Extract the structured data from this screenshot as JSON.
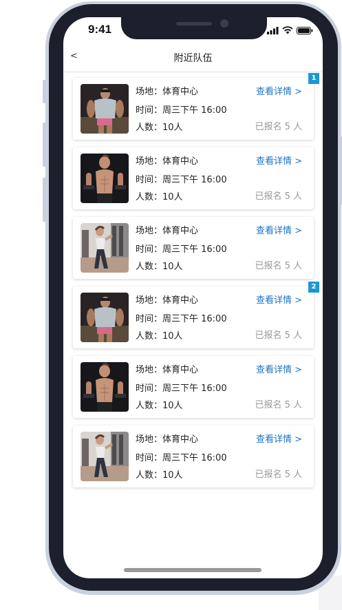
{
  "status_bar": {
    "time": "9:41"
  },
  "nav": {
    "back": "<",
    "title": "附近队伍"
  },
  "cards": [
    {
      "venue": "场地：体育中心",
      "time": "时间：周三下午 16:00",
      "people": "人数：10人",
      "link": "查看详情 >",
      "signed": "已报名 5 人",
      "photo": "bodybuilder-photo"
    },
    {
      "venue": "场地：体育中心",
      "time": "时间：周三下午 16:00",
      "people": "人数：10人",
      "link": "查看详情 >",
      "signed": "已报名 5 人",
      "photo": "dumbbell-man-photo"
    },
    {
      "venue": "场地：体育中心",
      "time": "时间：周三下午 16:00",
      "people": "人数：10人",
      "link": "查看详情 >",
      "signed": "已报名 5 人",
      "photo": "gym-woman-photo"
    },
    {
      "venue": "场地：体育中心",
      "time": "时间：周三下午 16:00",
      "people": "人数：10人",
      "link": "查看详情 >",
      "signed": "已报名 5 人",
      "photo": "bodybuilder-photo"
    },
    {
      "venue": "场地：体育中心",
      "time": "时间：周三下午 16:00",
      "people": "人数：10人",
      "link": "查看详情 >",
      "signed": "已报名 5 人",
      "photo": "dumbbell-man-photo"
    },
    {
      "venue": "场地：体育中心",
      "time": "时间：周三下午 16:00",
      "people": "人数：10人",
      "link": "查看详情 >",
      "signed": "已报名 5 人",
      "photo": "gym-woman-photo"
    }
  ],
  "badges": [
    "1",
    "2"
  ],
  "colors": {
    "link": "#1a73c8",
    "badge": "#1d97d4",
    "frame": "#1e1f2c",
    "bezel": "#c9d0de"
  }
}
